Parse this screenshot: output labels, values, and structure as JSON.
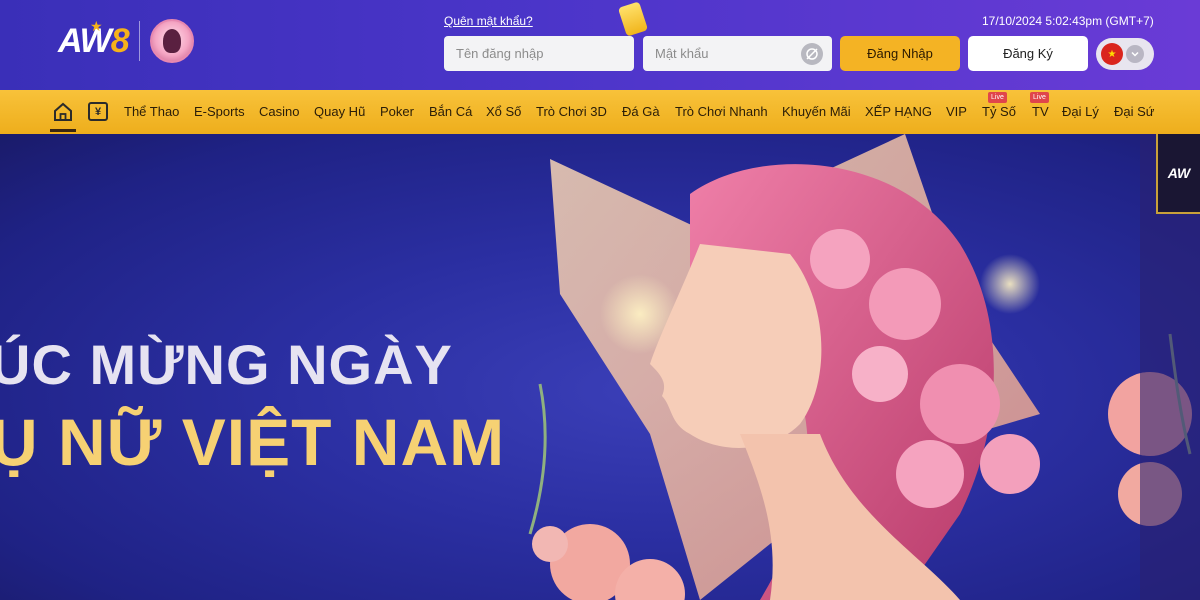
{
  "header": {
    "logo": {
      "text_main": "AW",
      "text_accent": "8"
    },
    "forgot_password": "Quên mật khẩu?",
    "datetime": "17/10/2024 5:02:43pm (GMT+7)",
    "username_placeholder": "Tên đăng nhập",
    "password_placeholder": "Mật khẩu",
    "login_label": "Đăng Nhập",
    "register_label": "Đăng Ký",
    "language": "vi"
  },
  "nav": {
    "items": [
      "Thể Thao",
      "E-Sports",
      "Casino",
      "Quay Hũ",
      "Poker",
      "Bắn Cá",
      "Xổ Số",
      "Trò Chơi 3D",
      "Đá Gà",
      "Trò Chơi Nhanh",
      "Khuyến Mãi",
      "XẾP HẠNG",
      "VIP",
      "Tỷ Số",
      "TV",
      "Đại Lý",
      "Đại Sứ"
    ],
    "live_badge": "Live"
  },
  "banner": {
    "line1": "ÚC MỪNG NGÀY",
    "line2": "Ụ NỮ VIỆT NAM",
    "corner_logo": "AW"
  },
  "colors": {
    "header_bg": "#4b35c9",
    "nav_bg": "#f4b324",
    "banner_bg": "#2b2fa2",
    "headline_white": "#e6e3f1",
    "headline_gold": "#f6d173"
  }
}
